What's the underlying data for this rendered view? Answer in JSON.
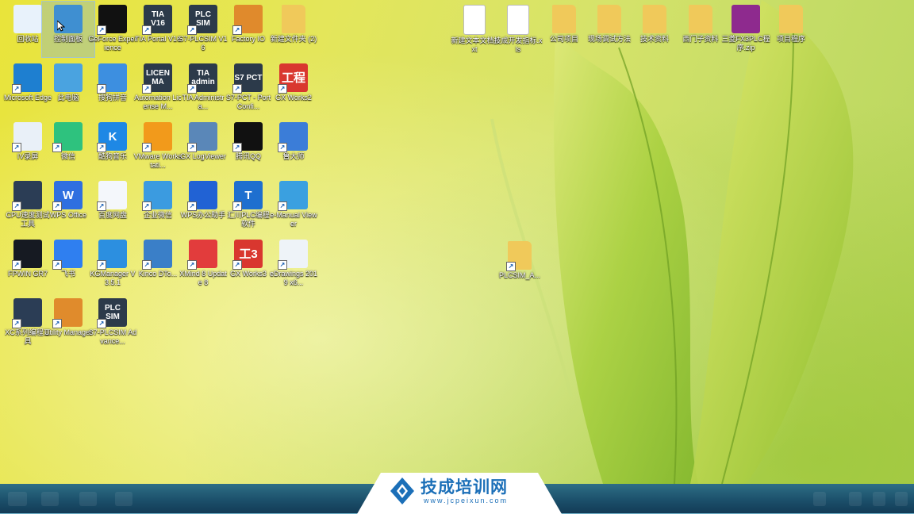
{
  "desktop": {
    "icons": [
      {
        "label": "回收站",
        "icon": "recycle-bin-icon",
        "shortcut": false
      },
      {
        "label": "控制面板",
        "icon": "control-panel-icon",
        "shortcut": false,
        "selected": true
      },
      {
        "label": "GeForce Experience",
        "icon": "nvidia-icon",
        "shortcut": true
      },
      {
        "label": "TIA Portal V16",
        "icon": "tia-portal-icon",
        "shortcut": true,
        "text": "TIA V16"
      },
      {
        "label": "S7-PLCSIM V16",
        "icon": "plcsim-icon",
        "shortcut": true,
        "text": "PLC SIM"
      },
      {
        "label": "Factory IO",
        "icon": "factory-io-icon",
        "shortcut": true
      },
      {
        "label": "新建文件夹 (2)",
        "icon": "folder-icon",
        "shortcut": false
      },
      {
        "label": "Microsoft Edge",
        "icon": "edge-icon",
        "shortcut": true
      },
      {
        "label": "此电脑",
        "icon": "computer-icon",
        "shortcut": false
      },
      {
        "label": "搜狗拼音",
        "icon": "ime-icon",
        "shortcut": true
      },
      {
        "label": "Automation License M...",
        "icon": "license-manager-icon",
        "shortcut": true,
        "text": "LICEN MA"
      },
      {
        "label": "TIA Administra...",
        "icon": "tia-admin-icon",
        "shortcut": true,
        "text": "TIA admin"
      },
      {
        "label": "S7-PCT - Port Confi...",
        "icon": "s7-pct-icon",
        "shortcut": true,
        "text": "S7 PCT"
      },
      {
        "label": "GX Works2",
        "icon": "gx-works2-icon",
        "shortcut": true,
        "text": "工程"
      },
      {
        "label": "IV录屏",
        "icon": "screen-recorder-icon",
        "shortcut": true
      },
      {
        "label": "微信",
        "icon": "wechat-icon",
        "shortcut": true
      },
      {
        "label": "酷狗音乐",
        "icon": "kugou-icon",
        "shortcut": true,
        "text": "K"
      },
      {
        "label": "VMware Workstati...",
        "icon": "vmware-icon",
        "shortcut": true
      },
      {
        "label": "GX LogViewer",
        "icon": "gx-logviewer-icon",
        "shortcut": true
      },
      {
        "label": "腾讯QQ",
        "icon": "qq-icon",
        "shortcut": true
      },
      {
        "label": "鲁大师",
        "icon": "ludashi-icon",
        "shortcut": true
      },
      {
        "label": "CPU速度测试工具",
        "icon": "cpu-tool-icon",
        "shortcut": true
      },
      {
        "label": "WPS Office",
        "icon": "wps-office-icon",
        "shortcut": true,
        "text": "W"
      },
      {
        "label": "百度网盘",
        "icon": "baidu-netdisk-icon",
        "shortcut": true
      },
      {
        "label": "企业微信",
        "icon": "wecom-icon",
        "shortcut": true
      },
      {
        "label": "WPS办公助手",
        "icon": "wps-assistant-icon",
        "shortcut": true
      },
      {
        "label": "汇川PLC编程软件",
        "icon": "inovance-icon",
        "shortcut": true,
        "text": "T"
      },
      {
        "label": "e-Manual Viewer",
        "icon": "emanual-icon",
        "shortcut": true
      },
      {
        "label": "FPWIN GR7",
        "icon": "fpwin-icon",
        "shortcut": true
      },
      {
        "label": "飞书",
        "icon": "feishu-icon",
        "shortcut": true
      },
      {
        "label": "KGManager V3.5.1",
        "icon": "kgmanager-icon",
        "shortcut": true
      },
      {
        "label": "Kinco DTo...",
        "icon": "kinco-icon",
        "shortcut": true
      },
      {
        "label": "XMind 8 Update 8",
        "icon": "xmind-icon",
        "shortcut": true
      },
      {
        "label": "GX Works3",
        "icon": "gx-works3-icon",
        "shortcut": true,
        "text": "工3"
      },
      {
        "label": "eDrawings 2019 x6...",
        "icon": "edrawings-icon",
        "shortcut": true
      },
      {
        "label": "XC系列编程工具",
        "icon": "xc-tool-icon",
        "shortcut": true
      },
      {
        "label": "Utility Manager",
        "icon": "utility-manager-icon",
        "shortcut": true
      },
      {
        "label": "S7-PLCSIM Advance...",
        "icon": "plcsim-advanced-icon",
        "shortcut": true,
        "text": "PLC SIM"
      },
      {
        "label": "新建文本文档.txt",
        "icon": "text-file-icon",
        "shortcut": false
      },
      {
        "label": "技成开发指标.xls",
        "icon": "excel-file-icon",
        "shortcut": false
      },
      {
        "label": "公司项目",
        "icon": "folder-icon",
        "shortcut": false
      },
      {
        "label": "现场调试方法",
        "icon": "folder-doc-icon",
        "shortcut": false
      },
      {
        "label": "技术资料",
        "icon": "folder-doc-icon",
        "shortcut": false
      },
      {
        "label": "西门子资料",
        "icon": "folder-doc-icon",
        "shortcut": false
      },
      {
        "label": "三菱FX3PLC程序.zip",
        "icon": "winrar-icon",
        "shortcut": false
      },
      {
        "label": "项目程序",
        "icon": "folder-doc-icon",
        "shortcut": false
      },
      {
        "label": "PLCSIM_A...",
        "icon": "folder-file-icon",
        "shortcut": true
      }
    ]
  },
  "watermark": {
    "name": "技成培训网",
    "url": "www.jcpeixun.com"
  },
  "colors": {
    "taskbar": "#1b4f6a",
    "brand": "#1b6fb8"
  }
}
